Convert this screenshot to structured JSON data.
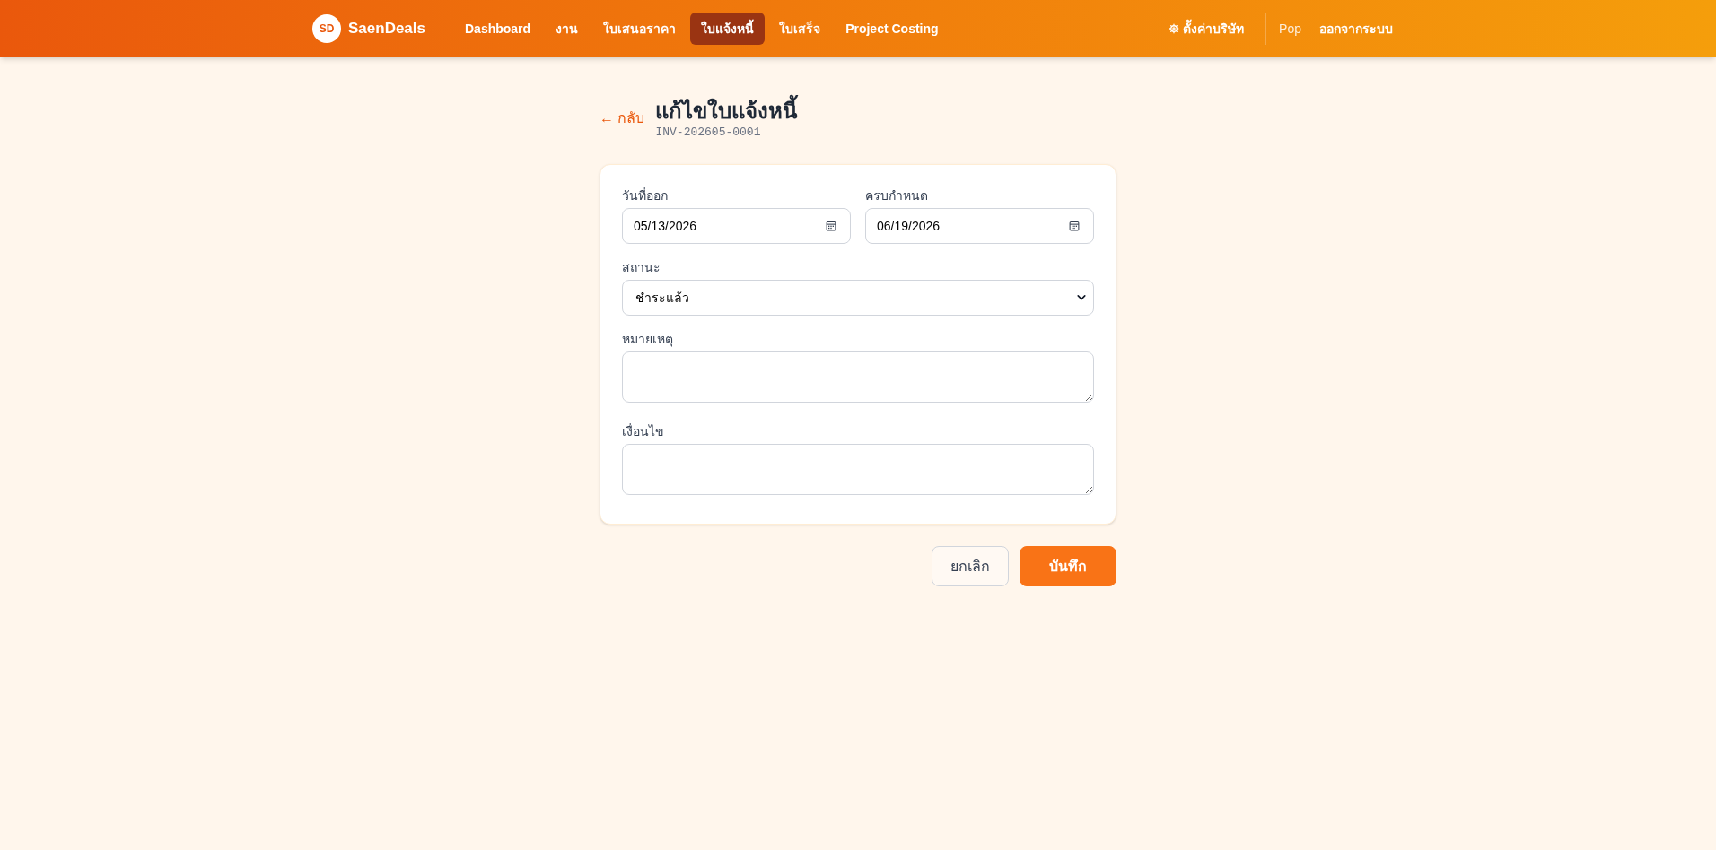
{
  "header": {
    "logo_mark": "SD",
    "brand": "SaenDeals",
    "nav": [
      {
        "label": "Dashboard",
        "selected": false
      },
      {
        "label": "งาน",
        "selected": false
      },
      {
        "label": "ใบเสนอราคา",
        "selected": false
      },
      {
        "label": "ใบแจ้งหนี้",
        "selected": true
      },
      {
        "label": "ใบเสร็จ",
        "selected": false
      },
      {
        "label": "Project Costing",
        "selected": false
      }
    ],
    "settings": "ตั้งค่าบริษัท",
    "user": "Pop",
    "logout": "ออกจากระบบ"
  },
  "page": {
    "back": "← กลับ",
    "title": "แก้ไขใบแจ้งหนี้",
    "doc_number": "INV-202605-0001"
  },
  "form": {
    "fields": [
      {
        "kind": "date",
        "label": "วันที่ออก",
        "value": "05/13/2026"
      },
      {
        "kind": "date",
        "label": "ครบกำหนด",
        "value": "06/19/2026"
      },
      {
        "kind": "select",
        "label": "สถานะ",
        "value": "ชำระแล้ว"
      },
      {
        "kind": "textarea",
        "label": "หมายเหตุ"
      },
      {
        "kind": "textarea",
        "label": "เงื่อนไข"
      }
    ]
  },
  "actions": [
    {
      "kind": "secondary",
      "label": "ยกเลิก"
    },
    {
      "kind": "primary",
      "label": "บันทึก"
    }
  ]
}
